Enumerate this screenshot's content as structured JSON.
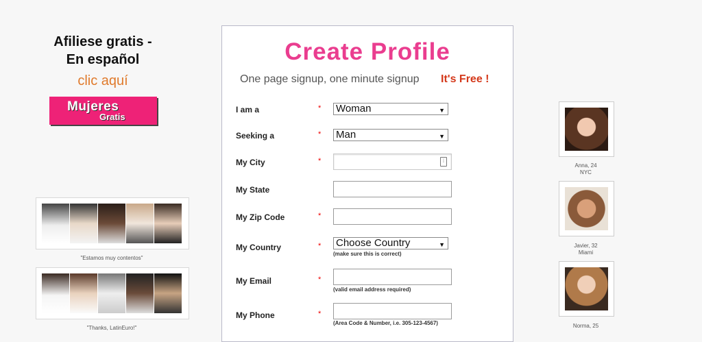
{
  "promo": {
    "line1": "Afiliese gratis -",
    "line2": "En español",
    "link": "clic aquí",
    "badge_big": "Mujeres",
    "badge_small": "Gratis"
  },
  "testimonials": [
    {
      "caption": "\"Estamos muy contentos\""
    },
    {
      "caption": "\"Thanks, LatinEuro!\""
    }
  ],
  "form": {
    "title": "Create Profile",
    "subtitle": "One page signup, one minute signup",
    "free": "It's Free !",
    "required_mark": "*",
    "fields": {
      "iam": {
        "label": "I am a",
        "value": "Woman"
      },
      "seeking": {
        "label": "Seeking a",
        "value": "Man"
      },
      "city": {
        "label": "My City",
        "value": ""
      },
      "state": {
        "label": "My State",
        "value": ""
      },
      "zip": {
        "label": "My Zip Code",
        "value": ""
      },
      "country": {
        "label": "My Country",
        "value": "Choose Country",
        "hint": "(make sure this is correct)"
      },
      "email": {
        "label": "My Email",
        "value": "",
        "hint": "(valid email address required)"
      },
      "phone": {
        "label": "My Phone",
        "value": "",
        "hint": "(Area Code & Number, i.e. 305-123-4567)"
      }
    }
  },
  "profiles": [
    {
      "name": "Anna, 24",
      "place": "NYC"
    },
    {
      "name": "Javier, 32",
      "place": "Miami"
    },
    {
      "name": "Norma, 25",
      "place": ""
    }
  ],
  "colors": {
    "accent": "#ea3d8f",
    "free": "#d4381a",
    "link": "#e07a2c",
    "badge": "#ee2277"
  }
}
